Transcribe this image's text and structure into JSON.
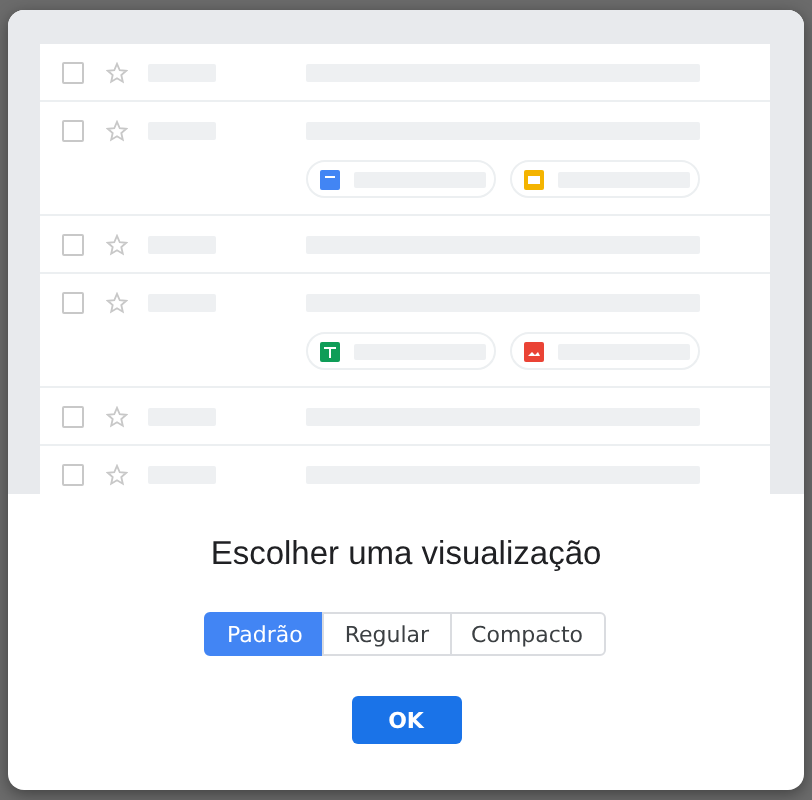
{
  "preview": {
    "rows": [
      {
        "checked": false,
        "starred": false,
        "attachments": []
      },
      {
        "checked": false,
        "starred": false,
        "attachments": [
          {
            "kind": "doc"
          },
          {
            "kind": "slides"
          }
        ]
      },
      {
        "checked": false,
        "starred": false,
        "attachments": []
      },
      {
        "checked": false,
        "starred": false,
        "attachments": [
          {
            "kind": "sheet"
          },
          {
            "kind": "image"
          }
        ]
      },
      {
        "checked": false,
        "starred": false,
        "attachments": []
      },
      {
        "checked": false,
        "starred": false,
        "attachments": []
      }
    ]
  },
  "dialog": {
    "title": "Escolher uma visualização",
    "options": [
      {
        "label": "Padrão",
        "selected": true
      },
      {
        "label": "Regular",
        "selected": false
      },
      {
        "label": "Compacto",
        "selected": false
      }
    ],
    "button": "OK"
  }
}
